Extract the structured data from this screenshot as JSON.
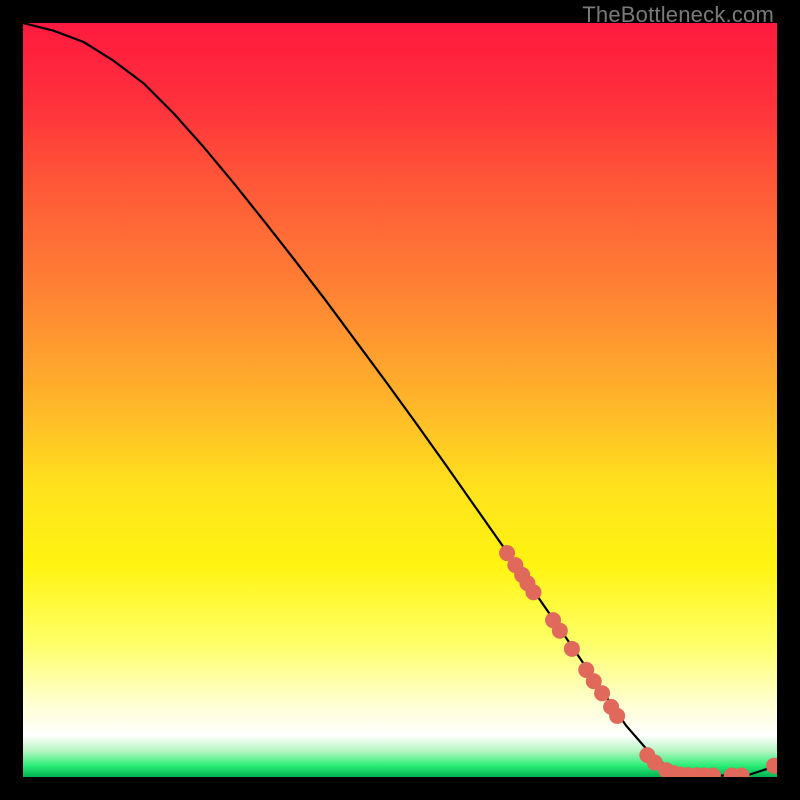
{
  "watermark": "TheBottleneck.com",
  "chart_data": {
    "type": "line",
    "title": "",
    "xlabel": "",
    "ylabel": "",
    "xlim": [
      0,
      100
    ],
    "ylim": [
      0,
      100
    ],
    "gradient_stops": [
      {
        "offset": 0.0,
        "color": "#ff1a3f"
      },
      {
        "offset": 0.1,
        "color": "#ff2f3c"
      },
      {
        "offset": 0.22,
        "color": "#ff5a38"
      },
      {
        "offset": 0.35,
        "color": "#ff8034"
      },
      {
        "offset": 0.5,
        "color": "#ffb42a"
      },
      {
        "offset": 0.62,
        "color": "#ffe31c"
      },
      {
        "offset": 0.72,
        "color": "#fff412"
      },
      {
        "offset": 0.82,
        "color": "#ffff66"
      },
      {
        "offset": 0.9,
        "color": "#ffffd0"
      },
      {
        "offset": 0.945,
        "color": "#ffffff"
      },
      {
        "offset": 0.965,
        "color": "#b8f5c4"
      },
      {
        "offset": 0.985,
        "color": "#2aee78"
      },
      {
        "offset": 1.0,
        "color": "#00b24f"
      }
    ],
    "curve": {
      "x": [
        0,
        4,
        8,
        12,
        16,
        20,
        24,
        28,
        32,
        36,
        40,
        44,
        48,
        52,
        56,
        60,
        64,
        68,
        72,
        76,
        80,
        84,
        88,
        92,
        96,
        100
      ],
      "y": [
        100,
        99,
        97.5,
        95,
        92,
        88,
        83.5,
        78.7,
        73.7,
        68.6,
        63.4,
        58.0,
        52.6,
        47.1,
        41.5,
        35.8,
        30.1,
        24.3,
        18.5,
        12.6,
        6.8,
        2.2,
        0.3,
        0.2,
        0.2,
        1.5
      ]
    },
    "points": [
      {
        "x": 64.2,
        "y": 29.7
      },
      {
        "x": 65.3,
        "y": 28.1
      },
      {
        "x": 66.2,
        "y": 26.8
      },
      {
        "x": 66.9,
        "y": 25.7
      },
      {
        "x": 67.7,
        "y": 24.5
      },
      {
        "x": 70.3,
        "y": 20.8
      },
      {
        "x": 71.2,
        "y": 19.4
      },
      {
        "x": 72.8,
        "y": 17.0
      },
      {
        "x": 74.7,
        "y": 14.2
      },
      {
        "x": 75.7,
        "y": 12.7
      },
      {
        "x": 76.8,
        "y": 11.1
      },
      {
        "x": 78.0,
        "y": 9.3
      },
      {
        "x": 78.8,
        "y": 8.1
      },
      {
        "x": 82.8,
        "y": 2.9
      },
      {
        "x": 83.8,
        "y": 1.9
      },
      {
        "x": 85.3,
        "y": 0.9
      },
      {
        "x": 86.3,
        "y": 0.5
      },
      {
        "x": 87.2,
        "y": 0.3
      },
      {
        "x": 88.2,
        "y": 0.25
      },
      {
        "x": 89.4,
        "y": 0.22
      },
      {
        "x": 90.4,
        "y": 0.2
      },
      {
        "x": 91.5,
        "y": 0.2
      },
      {
        "x": 94.0,
        "y": 0.2
      },
      {
        "x": 95.3,
        "y": 0.2
      },
      {
        "x": 99.6,
        "y": 1.5
      }
    ],
    "point_color": "#e0695b",
    "point_radius": 8
  }
}
